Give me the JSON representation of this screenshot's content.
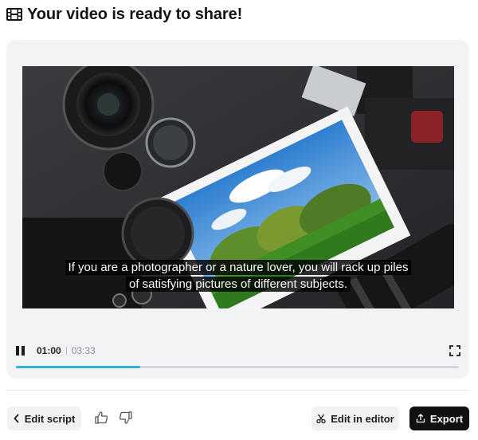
{
  "header": {
    "icon": "film-icon",
    "title": "Your video is ready to share!"
  },
  "player": {
    "caption": "If you are a photographer or a nature lover, you will rack up piles of satisfying pictures of different subjects.",
    "current_time": "01:00",
    "total_time": "03:33",
    "progress_fraction": 0.28,
    "accent_color": "#2fb3d9"
  },
  "actions": {
    "edit_script_label": "Edit script",
    "edit_in_editor_label": "Edit in editor",
    "export_label": "Export"
  },
  "icons": {
    "back": "chevron-left-icon",
    "thumbs_up": "thumbs-up-icon",
    "thumbs_down": "thumbs-down-icon",
    "scissors": "scissors-icon",
    "export": "share-icon",
    "pause": "pause-icon",
    "fullscreen": "fullscreen-icon"
  }
}
